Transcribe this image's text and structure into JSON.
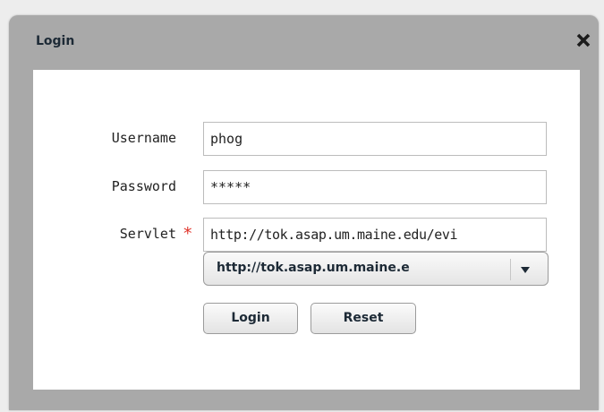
{
  "dialog": {
    "title": "Login",
    "close_icon": "close-icon"
  },
  "form": {
    "username_label": "Username",
    "username_value": "phog",
    "password_label": "Password",
    "password_value": "*****",
    "servlet_label": "Servlet",
    "servlet_required_mark": "*",
    "servlet_value": "http://tok.asap.um.maine.edu/evi",
    "servlet_select_value": "http://tok.asap.um.maine.e",
    "login_button": "Login",
    "reset_button": "Reset"
  },
  "colors": {
    "title_text": "#1d2a36",
    "required_mark": "#e0342a",
    "frame": "#a9a9a9"
  }
}
